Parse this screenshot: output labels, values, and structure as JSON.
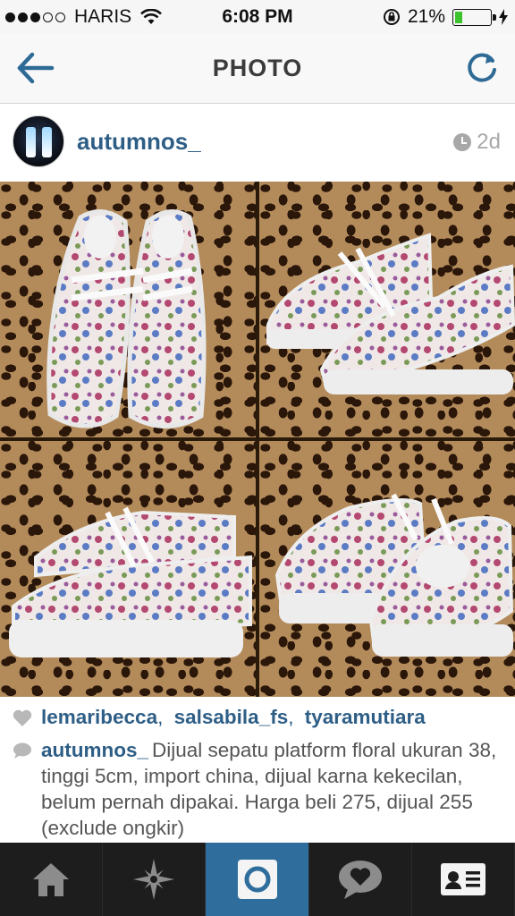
{
  "status_bar": {
    "carrier": "HARIS",
    "time": "6:08 PM",
    "battery": "21%",
    "battery_level": 0.21
  },
  "nav": {
    "title": "PHOTO",
    "back_icon": "back-arrow-icon",
    "refresh_icon": "refresh-icon"
  },
  "post": {
    "username": "autumnos_",
    "time_ago": "2d",
    "likers": [
      "lemaribecca",
      "salsabila_fs",
      "tyaramutiara"
    ],
    "caption_user": "autumnos_",
    "caption_text": "Dijual sepatu platform floral ukuran 38, tinggi 5cm, import china, dijual karna kekecilan, belum pernah dipakai. Harga beli 275, dijual 255 (exclude ongkir)"
  },
  "tab_bar": {
    "items": [
      {
        "icon": "home-icon",
        "active": false
      },
      {
        "icon": "explore-icon",
        "active": false
      },
      {
        "icon": "camera-icon",
        "active": true
      },
      {
        "icon": "activity-icon",
        "active": false
      },
      {
        "icon": "profile-icon",
        "active": false
      }
    ]
  },
  "colors": {
    "accent": "#2e5e86",
    "tab_active": "#2f6e9c",
    "tab_bar": "#1d1d1d",
    "battery": "#3dc32b"
  }
}
